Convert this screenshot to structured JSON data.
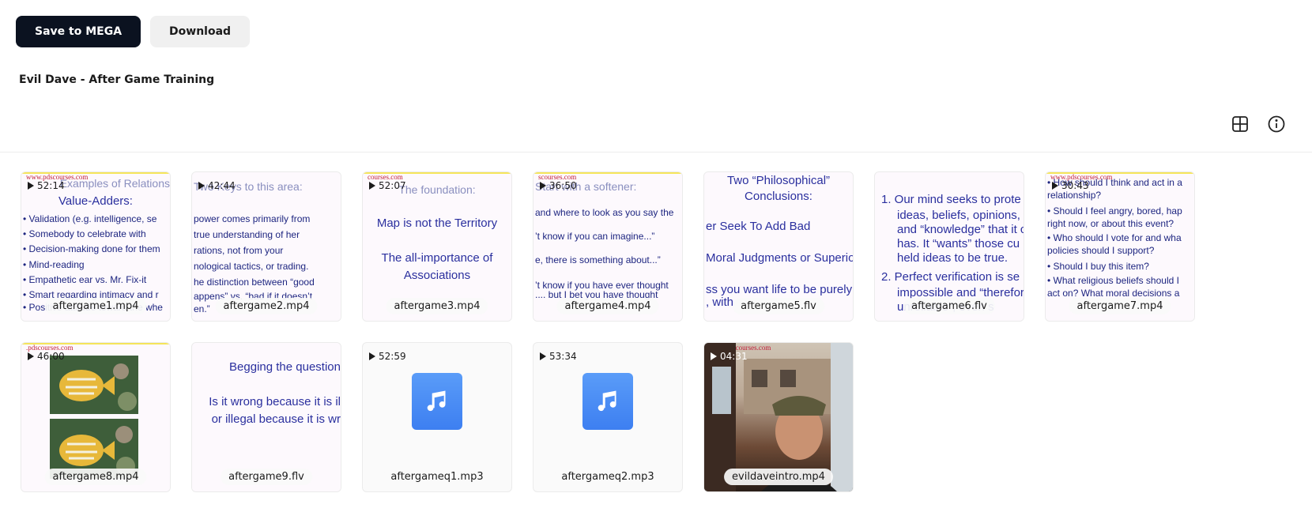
{
  "toolbar": {
    "save_label": "Save to MEGA",
    "download_label": "Download"
  },
  "folder": {
    "title": "Evil Dave - After Game Training"
  },
  "view_tools": {
    "grid_icon": "grid-view-icon",
    "info_icon": "info-icon"
  },
  "files": [
    {
      "name": "aftergame1.mp4",
      "duration": "52:14",
      "kind": "slide",
      "brand": "www.pdscourses.com",
      "lines": [
        "Examples of Relations",
        "Value-Adders:",
        "• Validation (e.g. intelligence, se",
        "• Somebody to celebrate with",
        "• Decision-making done for them",
        "• Mind-reading",
        "• Empathetic ear vs. Mr. Fix-it",
        "• Smart regarding intimacy and r",
        "• Positive attitude toward the whe"
      ]
    },
    {
      "name": "aftergame2.mp4",
      "duration": "42:44",
      "kind": "slide",
      "brand": "",
      "lines": [
        "Two Keys to this area:",
        "power comes primarily from",
        "true understanding of her",
        "rations, not from your",
        "nological tactics, or trading.",
        "he distinction between “good",
        "appens” vs. “bad if it doesn’t",
        "en.”"
      ]
    },
    {
      "name": "aftergame3.mp4",
      "duration": "52:07",
      "kind": "slide",
      "brand": "courses.com",
      "lines": [
        "The foundation:",
        "Map is not the Territory",
        "The all-importance of",
        "Associations"
      ]
    },
    {
      "name": "aftergame4.mp4",
      "duration": "36:50",
      "kind": "slide",
      "brand": "scourses.com",
      "lines": [
        "Start with a softener:",
        "and where to look as you say the",
        "’t know if you can imagine...”",
        "e, there is something about...”",
        "’t know if you have ever thought",
        ".... but I bet you have thought"
      ]
    },
    {
      "name": "aftergame5.flv",
      "duration": "",
      "kind": "slide",
      "brand": "",
      "lines": [
        "Two “Philosophical”",
        "Conclusions:",
        "er Seek To Add Bad",
        "Moral Judgments or Superio",
        "ss you want life to be purely",
        ", with"
      ]
    },
    {
      "name": "aftergame6.flv",
      "duration": "",
      "kind": "slide",
      "brand": "",
      "lines": [
        "1.  Our mind seeks to prote",
        "ideas, beliefs, opinions,",
        "and “knowledge” that it c",
        "has.  It “wants” those cu",
        "held ideas to be true.",
        "2.  Perfect verification is se",
        "impossible and “therefor",
        "unreliable”, even s"
      ]
    },
    {
      "name": "aftergame7.mp4",
      "duration": "30:43",
      "kind": "slide",
      "brand": "www.pdscourses.com",
      "lines": [
        "• How should I think and act in a",
        "relationship?",
        "• Should I feel angry, bored, hap",
        "right now, or about this event?",
        "• Who should I vote for and wha",
        "policies should I support?",
        "• Should I buy this item?",
        "• What religious beliefs should I",
        "act on?  What moral decisions a"
      ]
    },
    {
      "name": "aftergame8.mp4",
      "duration": "46:00",
      "kind": "fish",
      "brand": ".pdscourses.com",
      "lines": []
    },
    {
      "name": "aftergame9.flv",
      "duration": "",
      "kind": "slide",
      "brand": "",
      "lines": [
        "Begging the question",
        "Is it wrong because it is il",
        "or illegal because it is wr"
      ]
    },
    {
      "name": "aftergameq1.mp3",
      "duration": "52:59",
      "kind": "audio",
      "brand": "",
      "lines": []
    },
    {
      "name": "aftergameq2.mp3",
      "duration": "53:34",
      "kind": "audio",
      "brand": "",
      "lines": []
    },
    {
      "name": "evildaveintro.mp4",
      "duration": "04:31",
      "kind": "photo",
      "brand": "www.pdscourses.com",
      "lines": []
    }
  ]
}
